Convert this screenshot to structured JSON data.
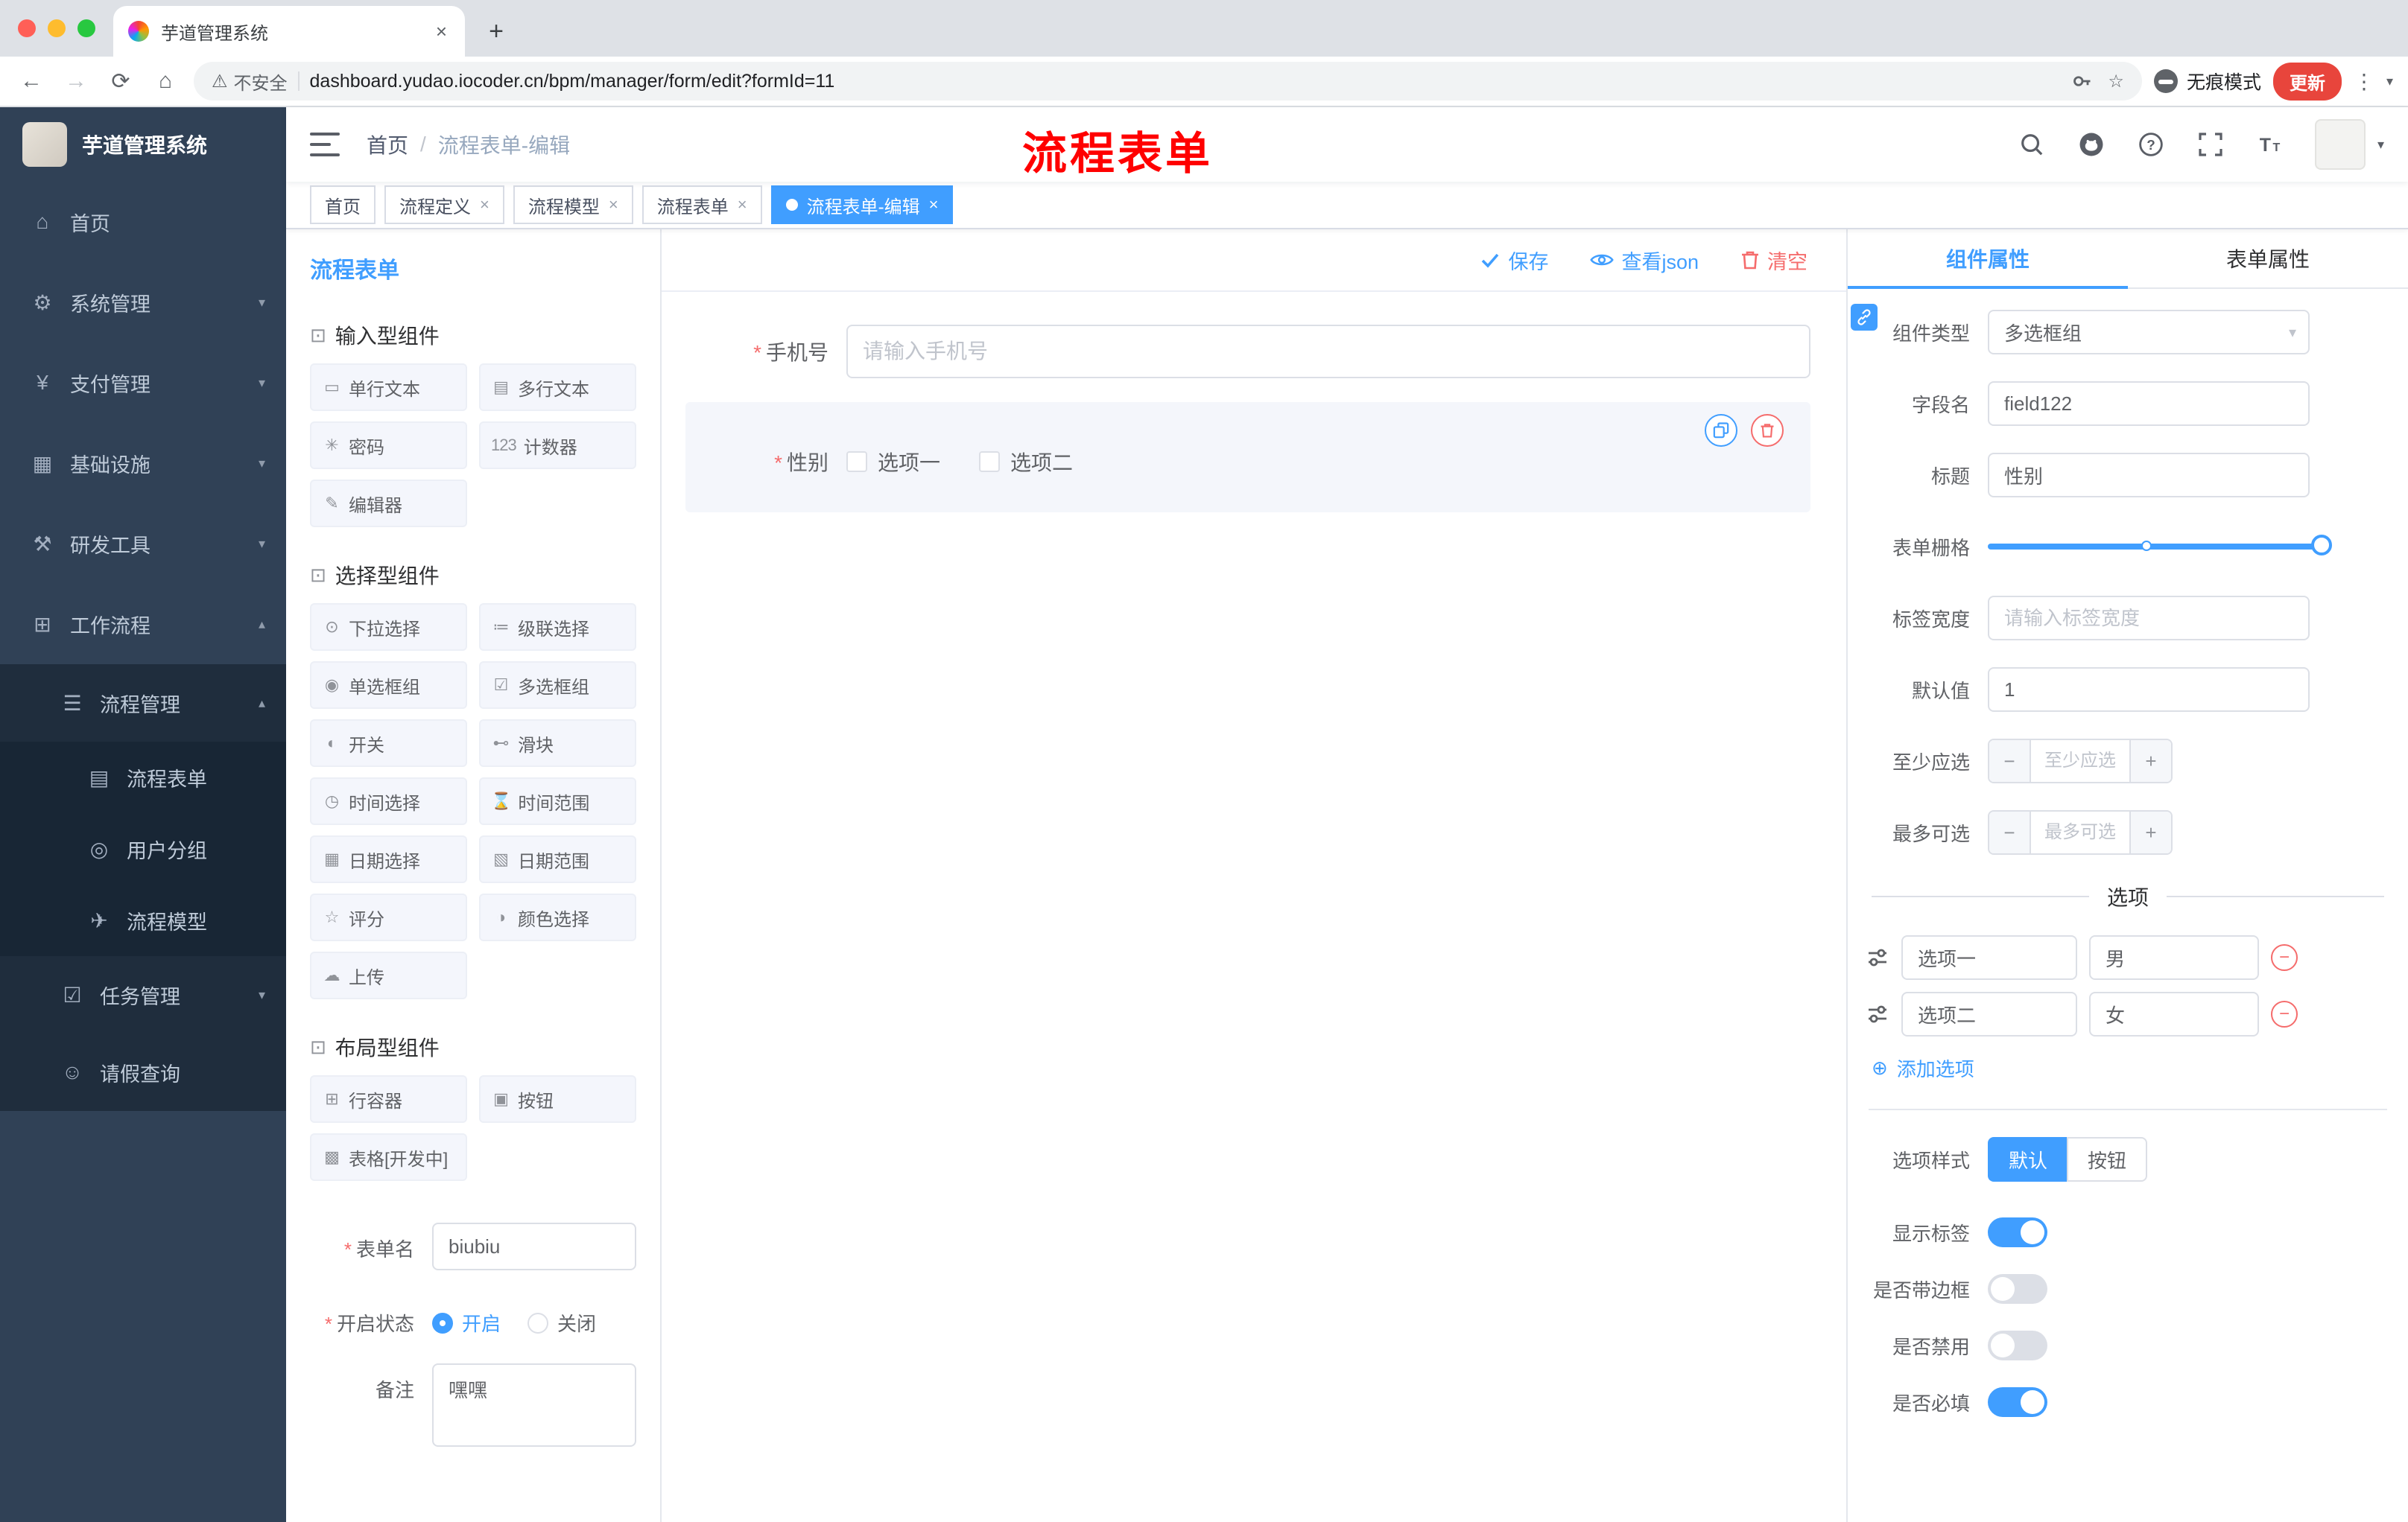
{
  "colors": {
    "accent": "#409eff",
    "danger": "#f56c6c",
    "overlay_red": "#ff0000",
    "sidebar_bg": "#304156",
    "sidebar_sub_bg": "#1f2d3d",
    "tabstrip_bg": "#dee1e6",
    "update_pill": "#e8453c"
  },
  "browser": {
    "tab_title": "芋道管理系统",
    "security": "不安全",
    "url": "dashboard.yudao.iocoder.cn/bpm/manager/form/edit?formId=11",
    "incognito": "无痕模式",
    "update": "更新"
  },
  "sidebar": {
    "brand": "芋道管理系统",
    "items": [
      {
        "label": "首页",
        "glyph": "⌂"
      },
      {
        "label": "系统管理",
        "glyph": "⚙"
      },
      {
        "label": "支付管理",
        "glyph": "¥"
      },
      {
        "label": "基础设施",
        "glyph": "▦"
      },
      {
        "label": "研发工具",
        "glyph": "⚒"
      },
      {
        "label": "工作流程",
        "glyph": "⊞"
      },
      {
        "label": "流程管理",
        "glyph": "☰"
      },
      {
        "label": "流程表单",
        "glyph": "▤"
      },
      {
        "label": "用户分组",
        "glyph": "◎"
      },
      {
        "label": "流程模型",
        "glyph": "✈"
      },
      {
        "label": "任务管理",
        "glyph": "☑"
      },
      {
        "label": "请假查询",
        "glyph": "☺"
      }
    ]
  },
  "header": {
    "breadcrumb_home": "首页",
    "breadcrumb_sep": "/",
    "breadcrumb_current": "流程表单-编辑",
    "overlay_title": "流程表单"
  },
  "tags": [
    {
      "label": "首页"
    },
    {
      "label": "流程定义"
    },
    {
      "label": "流程模型"
    },
    {
      "label": "流程表单"
    },
    {
      "label": "流程表单-编辑"
    }
  ],
  "palette": {
    "title": "流程表单",
    "groups": [
      {
        "name": "输入型组件",
        "items": [
          {
            "label": "单行文本",
            "glyph": "▭"
          },
          {
            "label": "多行文本",
            "glyph": "▤"
          },
          {
            "label": "密码",
            "glyph": "✳"
          },
          {
            "label": "计数器",
            "glyph": "123"
          },
          {
            "label": "编辑器",
            "glyph": "✎"
          }
        ]
      },
      {
        "name": "选择型组件",
        "items": [
          {
            "label": "下拉选择",
            "glyph": "⊙"
          },
          {
            "label": "级联选择",
            "glyph": "≔"
          },
          {
            "label": "单选框组",
            "glyph": "◉"
          },
          {
            "label": "多选框组",
            "glyph": "☑"
          },
          {
            "label": "开关",
            "glyph": "◐"
          },
          {
            "label": "滑块",
            "glyph": "⊷"
          },
          {
            "label": "时间选择",
            "glyph": "◷"
          },
          {
            "label": "时间范围",
            "glyph": "⌛"
          },
          {
            "label": "日期选择",
            "glyph": "▦"
          },
          {
            "label": "日期范围",
            "glyph": "▧"
          },
          {
            "label": "评分",
            "glyph": "☆"
          },
          {
            "label": "颜色选择",
            "glyph": "◑"
          },
          {
            "label": "上传",
            "glyph": "☁"
          }
        ]
      },
      {
        "name": "布局型组件",
        "items": [
          {
            "label": "行容器",
            "glyph": "⊞"
          },
          {
            "label": "按钮",
            "glyph": "▣"
          },
          {
            "label": "表格[开发中]",
            "glyph": "▩"
          }
        ]
      }
    ],
    "form": {
      "name_label": "表单名",
      "name_value": "biubiu",
      "status_label": "开启状态",
      "status_on": "开启",
      "status_off": "关闭",
      "remark_label": "备注",
      "remark_value": "嘿嘿"
    }
  },
  "canvas": {
    "actions": {
      "save": "保存",
      "view_json": "查看json",
      "clear": "清空"
    },
    "phone": {
      "label": "手机号",
      "placeholder": "请输入手机号"
    },
    "gender": {
      "label": "性别",
      "option1": "选项一",
      "option2": "选项二"
    }
  },
  "props": {
    "tab_component": "组件属性",
    "tab_form": "表单属性",
    "component_type_label": "组件类型",
    "component_type_value": "多选框组",
    "field_name_label": "字段名",
    "field_name_value": "field122",
    "title_label": "标题",
    "title_value": "性别",
    "grid_label": "表单栅格",
    "label_width_label": "标签宽度",
    "label_width_placeholder": "请输入标签宽度",
    "default_label": "默认值",
    "default_value": "1",
    "min_label": "至少应选",
    "min_placeholder": "至少应选",
    "max_label": "最多可选",
    "max_placeholder": "最多可选",
    "options_title": "选项",
    "options": [
      {
        "label": "选项一",
        "value": "男"
      },
      {
        "label": "选项二",
        "value": "女"
      }
    ],
    "add_option": "添加选项",
    "style_label": "选项样式",
    "style_default": "默认",
    "style_button": "按钮",
    "switch_show_label": "显示标签",
    "switch_border": "是否带边框",
    "switch_disabled": "是否禁用",
    "switch_required": "是否必填"
  }
}
